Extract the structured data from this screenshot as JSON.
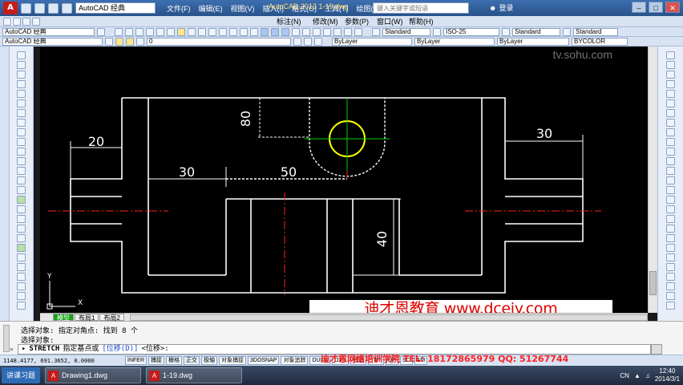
{
  "app": {
    "logo_text": "A",
    "workspace": "AutoCAD 经典",
    "title": "AutoCAD 2013    1-19.dwg",
    "search_placeholder": "键入关键字或短语",
    "login_label": "登录",
    "watermark": "tv.sohu.com"
  },
  "menu": [
    "文件(F)",
    "编辑(E)",
    "视图(V)",
    "插入(I)",
    "格式(O)",
    "工具(T)",
    "绘图(D)",
    "标注(N)",
    "修改(M)",
    "参数(P)",
    "窗口(W)",
    "帮助(H)"
  ],
  "toolbar": {
    "workspace_select": "AutoCAD 经典",
    "layer_value": "0",
    "text_style": "Standard",
    "dim_style": "ISO-25",
    "table_style": "Standard",
    "multileader_style": "Standard",
    "color": "ByLayer",
    "linetype": "ByLayer",
    "lineweight": "ByLayer",
    "plot_style": "BYCOLOR"
  },
  "drawing": {
    "dimensions": [
      "20",
      "30",
      "50",
      "80",
      "30",
      "40"
    ],
    "axis_x": "X",
    "axis_y": "Y"
  },
  "promo_banner": "迪才恩教育 www.dcejy.com",
  "layout_tabs": [
    "模型",
    "布局1",
    "布局2"
  ],
  "command": {
    "history": [
      "选择对象: 指定对角点: 找到 8 个",
      "选择对象:"
    ],
    "command_name": "STRETCH",
    "prompt": "指定基点或",
    "option": "[位移(D)]",
    "default": "<位移>:"
  },
  "status": {
    "coords": "1148.4177, 691.3652, 0.0000",
    "buttons": [
      "INFER",
      "捕捉",
      "栅格",
      "正交",
      "极轴",
      "对象捕捉",
      "3DOSNAP",
      "对象追踪",
      "DUCS",
      "DYN",
      "线宽",
      "TPY",
      "QP",
      "SC",
      "AM"
    ]
  },
  "ad_text": "迪才恩网络培训学院 TEL: 18172865979  QQ: 51267744",
  "taskbar": {
    "start_label": "讲课习题",
    "items": [
      "Drawing1.dwg",
      "1-19.dwg"
    ],
    "lang": "CN",
    "time": "12:40",
    "date": "2014/3/1"
  }
}
